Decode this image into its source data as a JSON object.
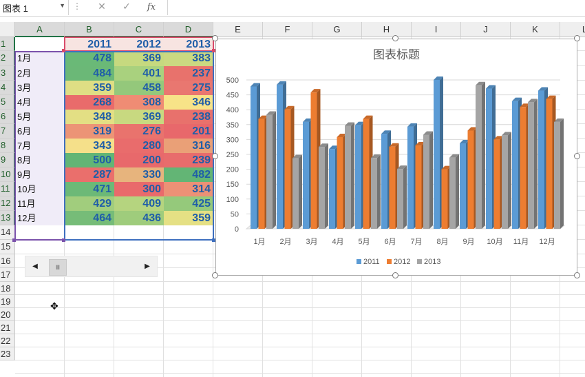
{
  "formula_bar": {
    "name_box": "图表 1",
    "sep": "⋮",
    "cancel_icon": "✕",
    "enter_icon": "✓",
    "fx_label": "fx",
    "formula": ""
  },
  "columns": [
    "A",
    "B",
    "C",
    "D",
    "E",
    "F",
    "G",
    "H",
    "I",
    "J",
    "K",
    "L"
  ],
  "rows": [
    "1",
    "2",
    "3",
    "4",
    "5",
    "6",
    "7",
    "8",
    "9",
    "10",
    "11",
    "12",
    "13",
    "14",
    "15",
    "16",
    "17",
    "18",
    "19",
    "20",
    "21",
    "22",
    "23"
  ],
  "table": {
    "headers": [
      "2011",
      "2012",
      "2013"
    ],
    "months": [
      "1月",
      "2月",
      "3月",
      "4月",
      "5月",
      "6月",
      "7月",
      "8月",
      "9月",
      "10月",
      "11月",
      "12月"
    ],
    "data": [
      [
        478,
        369,
        383
      ],
      [
        484,
        401,
        237
      ],
      [
        359,
        458,
        275
      ],
      [
        268,
        308,
        346
      ],
      [
        348,
        369,
        238
      ],
      [
        319,
        276,
        201
      ],
      [
        343,
        280,
        316
      ],
      [
        500,
        200,
        239
      ],
      [
        287,
        330,
        482
      ],
      [
        471,
        300,
        314
      ],
      [
        429,
        409,
        425
      ],
      [
        464,
        436,
        359
      ]
    ],
    "colors": [
      [
        "#6ab977",
        "#c6d97f",
        "#cbd981"
      ],
      [
        "#6bb877",
        "#a9d17e",
        "#e8726c"
      ],
      [
        "#dfde84",
        "#94c87b",
        "#e97770"
      ],
      [
        "#e96b6b",
        "#ef8c74",
        "#f7e388"
      ],
      [
        "#e3df84",
        "#c8d980",
        "#e8716c"
      ],
      [
        "#ec9476",
        "#e9736d",
        "#e8686b"
      ],
      [
        "#f5e08a",
        "#e96c6c",
        "#eaa077"
      ],
      [
        "#62b575",
        "#e8696b",
        "#e86c6c"
      ],
      [
        "#ea6f6c",
        "#e7b47d",
        "#63b575"
      ],
      [
        "#6cb977",
        "#e96a6b",
        "#ec9176"
      ],
      [
        "#a1cd7d",
        "#b5d47f",
        "#95c97b"
      ],
      [
        "#76bc78",
        "#9fcc7c",
        "#e5e084"
      ]
    ]
  },
  "scrollbar": {
    "left_arrow": "◀",
    "right_arrow": "▶",
    "thumb_glyph": "Ⅲ"
  },
  "chart_data": {
    "type": "bar",
    "title": "图表标题",
    "categories": [
      "1月",
      "2月",
      "3月",
      "4月",
      "5月",
      "6月",
      "7月",
      "8月",
      "9月",
      "10月",
      "11月",
      "12月"
    ],
    "series": [
      {
        "name": "2011",
        "values": [
          478,
          484,
          359,
          268,
          348,
          319,
          343,
          500,
          287,
          471,
          429,
          464
        ],
        "color": "#5b9bd5"
      },
      {
        "name": "2012",
        "values": [
          369,
          401,
          458,
          308,
          369,
          276,
          280,
          200,
          330,
          300,
          409,
          436
        ],
        "color": "#ed7d31"
      },
      {
        "name": "2013",
        "values": [
          383,
          237,
          275,
          346,
          238,
          201,
          316,
          239,
          482,
          314,
          425,
          359
        ],
        "color": "#a5a5a5"
      }
    ],
    "ylim": [
      0,
      500
    ],
    "yticks": [
      "0",
      "50",
      "100",
      "150",
      "200",
      "250",
      "300",
      "350",
      "400",
      "450",
      "500"
    ],
    "grid": true,
    "legend": "bottom"
  }
}
